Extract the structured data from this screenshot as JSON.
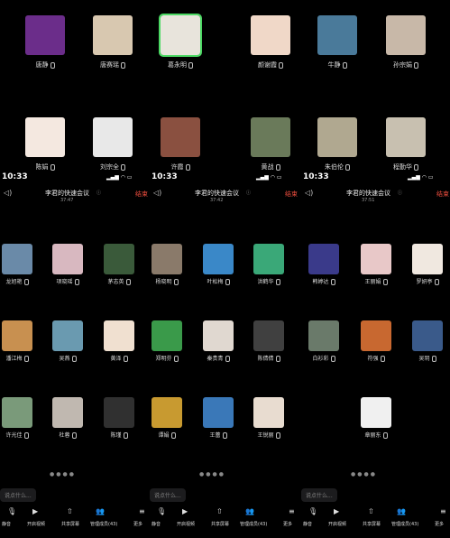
{
  "top_grid": {
    "participants": [
      {
        "name": "唐静",
        "icon": "mic-icon",
        "color": "#6b2d8a",
        "hl": false
      },
      {
        "name": "唐赛瑶",
        "icon": "mic-icon",
        "color": "#d8c8b0",
        "hl": false
      },
      {
        "name": "葛永明",
        "icon": "mic-icon",
        "color": "#e8e4dc",
        "hl": true
      },
      {
        "name": "颜谢霞",
        "icon": "mic-icon",
        "color": "#f0d8c8",
        "hl": false
      },
      {
        "name": "牛静",
        "icon": "mic-icon",
        "color": "#4a7a9a",
        "hl": false
      },
      {
        "name": "孙宗娟",
        "icon": "mic-icon",
        "color": "#c8b8a8",
        "hl": false
      },
      {
        "name": "陈娟",
        "icon": "mic-icon",
        "color": "#f4e8e0",
        "hl": false
      },
      {
        "name": "刘宗全",
        "icon": "mic-icon",
        "color": "#e8e8e8",
        "hl": false
      },
      {
        "name": "许霞",
        "icon": "mic-icon",
        "color": "#8a5040",
        "hl": false
      },
      {
        "name": "黄战",
        "icon": "mic-icon",
        "color": "#6a7a5a",
        "hl": false
      },
      {
        "name": "朱伯伦",
        "icon": "mic-icon",
        "color": "#b0a890",
        "hl": false
      },
      {
        "name": "程勤华",
        "icon": "mic-icon",
        "color": "#c8c0b0",
        "hl": false
      }
    ]
  },
  "screens": [
    {
      "time": "10:33",
      "title": "李君的快速会议",
      "duration": "37:47",
      "end_label": "结束",
      "participants": [
        {
          "name": "龙旭艳",
          "color": "#6a8aa8"
        },
        {
          "name": "项晓瑶",
          "color": "#d8b8c0"
        },
        {
          "name": "茅志英",
          "color": "#3a5a3a"
        },
        {
          "name": "潘江梅",
          "color": "#c89050"
        },
        {
          "name": "吴燕",
          "color": "#6a9ab0"
        },
        {
          "name": "黄泽",
          "color": "#f0e0d0"
        },
        {
          "name": "许光佳",
          "color": "#7a9a7a"
        },
        {
          "name": "杜蓉",
          "color": "#c0b8b0"
        },
        {
          "name": "陈瑾",
          "color": "#303030"
        }
      ],
      "input_placeholder": "说点什么...",
      "toolbar": [
        "静音",
        "开启视频",
        "共享屏幕",
        "管理成员(43)",
        "更多"
      ]
    },
    {
      "time": "10:33",
      "title": "李君的快速会议",
      "duration": "37:42",
      "end_label": "结束",
      "participants": [
        {
          "name": "杨晓明",
          "color": "#8a7a6a"
        },
        {
          "name": "叶松梅",
          "color": "#3a88c8"
        },
        {
          "name": "洪鹤华",
          "color": "#3aa878"
        },
        {
          "name": "郑明芬",
          "color": "#3a9a4a"
        },
        {
          "name": "秦贵青",
          "color": "#e0d8d0"
        },
        {
          "name": "陈倩倩",
          "color": "#404040"
        },
        {
          "name": "谭娟",
          "color": "#c89a30"
        },
        {
          "name": "王蕾",
          "color": "#3a78b8"
        },
        {
          "name": "王锐丽",
          "color": "#e8dcd0"
        }
      ],
      "input_placeholder": "说点什么...",
      "toolbar": [
        "静音",
        "开启视频",
        "共享屏幕",
        "管理成员(43)",
        "更多"
      ]
    },
    {
      "time": "10:33",
      "title": "李君的快速会议",
      "duration": "37:51",
      "end_label": "结束",
      "participants": [
        {
          "name": "韩婷达",
          "color": "#3a3a8a"
        },
        {
          "name": "王丽娟",
          "color": "#e8c8c8"
        },
        {
          "name": "罗妍亭",
          "color": "#f0e8e0"
        },
        {
          "name": "白衫彩",
          "color": "#6a7a6a"
        },
        {
          "name": "符强",
          "color": "#c86830"
        },
        {
          "name": "吴玥",
          "color": "#3a5a8a"
        },
        {
          "name": "章丽东",
          "color": "#f0f0f0"
        }
      ],
      "input_placeholder": "说点什么...",
      "toolbar": [
        "静音",
        "开启视频",
        "共享屏幕",
        "管理成员(43)",
        "更多"
      ]
    }
  ]
}
